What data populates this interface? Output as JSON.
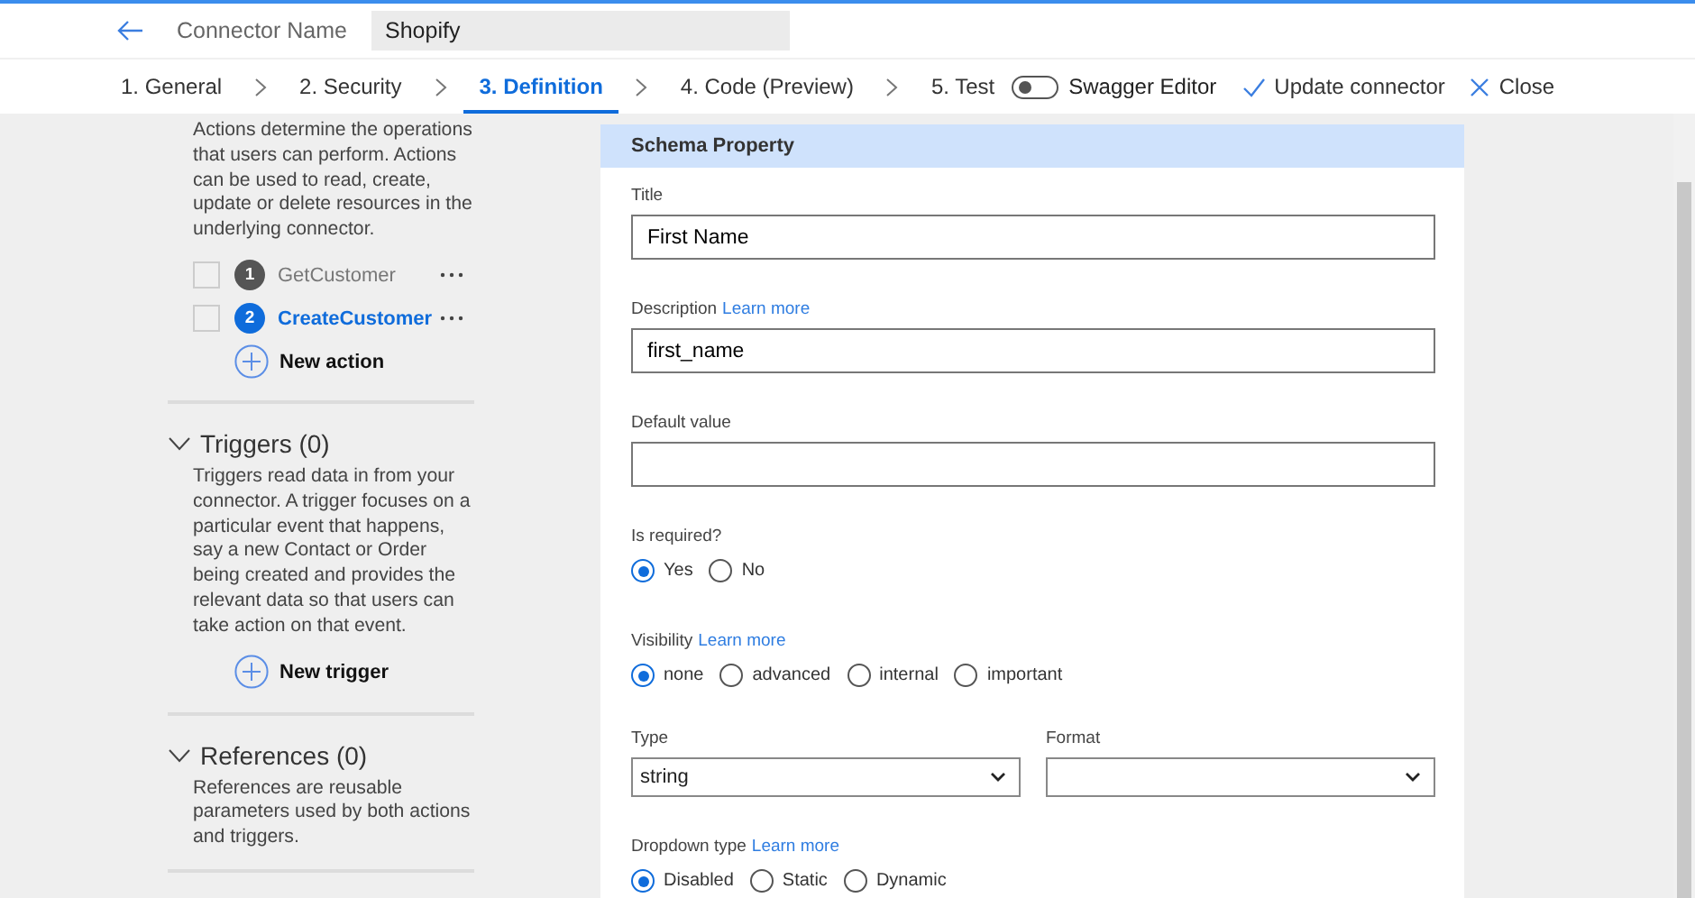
{
  "header": {
    "label": "Connector Name",
    "connector_name": "Shopify"
  },
  "steps": [
    {
      "label": "1. General",
      "selected": false
    },
    {
      "label": "2. Security",
      "selected": false
    },
    {
      "label": "3. Definition",
      "selected": true
    },
    {
      "label": "4. Code (Preview)",
      "selected": false
    },
    {
      "label": "5. Test",
      "selected": false
    }
  ],
  "swagger_editor": {
    "label": "Swagger Editor",
    "on": false
  },
  "commands": [
    {
      "kind": "check",
      "label": "Update connector"
    },
    {
      "kind": "close",
      "label": "Close"
    }
  ],
  "sidebar": {
    "actions_description": "Actions determine the operations that users can perform. Actions can be used to read, create, update or delete resources in the underlying connector.",
    "actions": [
      {
        "number": "1",
        "name": "GetCustomer",
        "selected": false,
        "checked": false
      },
      {
        "number": "2",
        "name": "CreateCustomer",
        "selected": true,
        "checked": false
      }
    ],
    "new_action": "New action",
    "sections": [
      {
        "title": "Triggers (0)",
        "expanded": true,
        "description": "Triggers read data in from your connector. A trigger focuses on a particular event that happens, say a new Contact or Order being created and provides the relevant data so that users can take action on that event.",
        "add_label": "New trigger"
      },
      {
        "title": "References (0)",
        "expanded": true,
        "description": "References are reusable parameters used by both actions and triggers."
      }
    ]
  },
  "schema": {
    "title": "Schema Property",
    "fields": [
      {
        "kind": "text",
        "label": "Title",
        "value": "First Name"
      },
      {
        "kind": "text",
        "label": "Description",
        "link": "Learn more",
        "value": "first_name"
      },
      {
        "kind": "text",
        "label": "Default value"
      },
      {
        "kind": "radio",
        "label": "Is required?",
        "options": [
          {
            "label": "Yes",
            "selected": true
          },
          {
            "label": "No",
            "selected": false
          }
        ]
      },
      {
        "kind": "radio",
        "label": "Visibility",
        "link": "Learn more",
        "options": [
          {
            "label": "none",
            "selected": true
          },
          {
            "label": "advanced",
            "selected": false
          },
          {
            "label": "internal",
            "selected": false
          },
          {
            "label": "important",
            "selected": false
          }
        ]
      },
      {
        "kind": "selects",
        "items": [
          {
            "label": "Type",
            "value": "string"
          },
          {
            "label": "Format"
          }
        ]
      },
      {
        "kind": "radio",
        "label": "Dropdown type",
        "link": "Learn more",
        "options": [
          {
            "label": "Disabled",
            "selected": true
          },
          {
            "label": "Static",
            "selected": false
          },
          {
            "label": "Dynamic",
            "selected": false
          }
        ]
      }
    ]
  }
}
